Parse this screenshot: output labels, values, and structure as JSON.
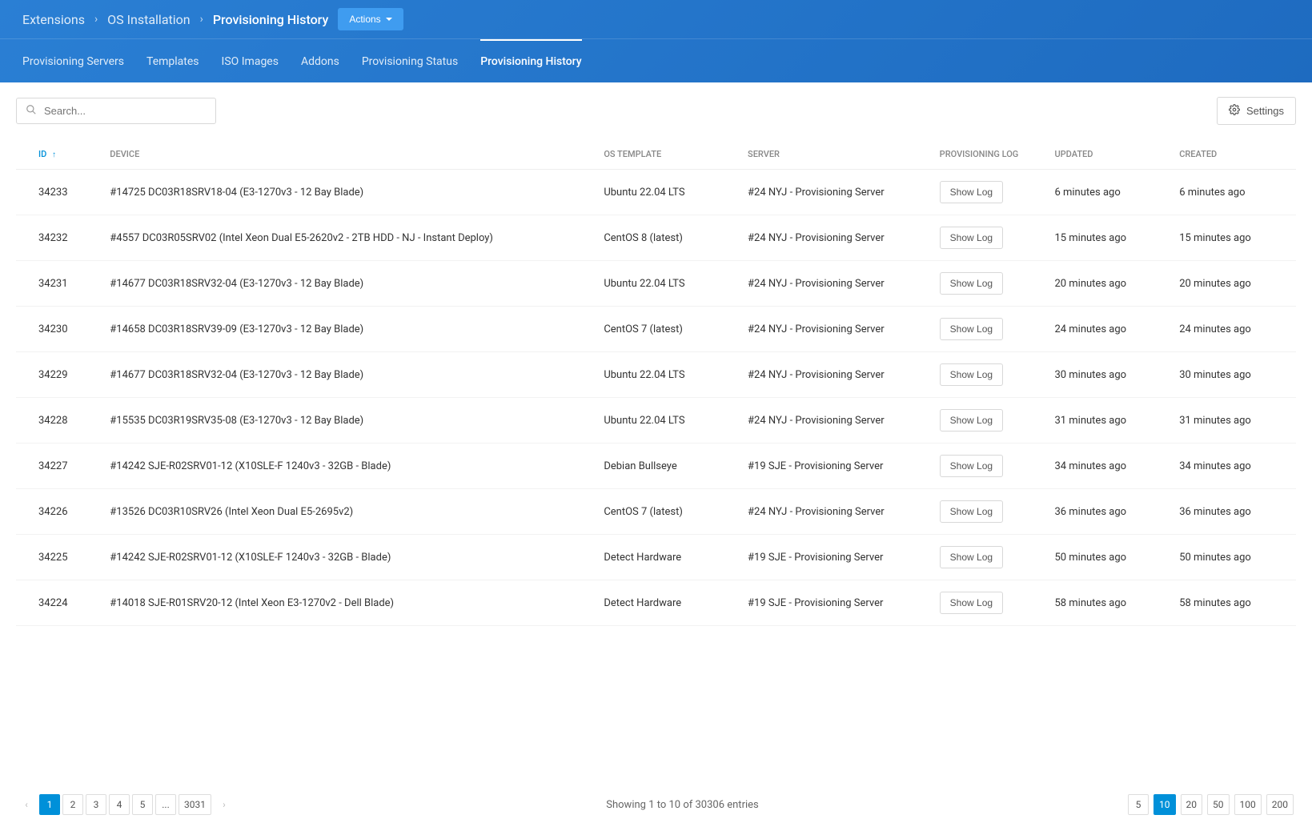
{
  "breadcrumb": {
    "items": [
      "Extensions",
      "OS Installation",
      "Provisioning History"
    ],
    "actions_label": "Actions"
  },
  "tabs": [
    {
      "label": "Provisioning Servers",
      "active": false
    },
    {
      "label": "Templates",
      "active": false
    },
    {
      "label": "ISO Images",
      "active": false
    },
    {
      "label": "Addons",
      "active": false
    },
    {
      "label": "Provisioning Status",
      "active": false
    },
    {
      "label": "Provisioning History",
      "active": true
    }
  ],
  "search": {
    "placeholder": "Search..."
  },
  "settings_label": "Settings",
  "columns": {
    "id": "ID",
    "device": "DEVICE",
    "os_template": "OS TEMPLATE",
    "server": "SERVER",
    "provisioning_log": "PROVISIONING LOG",
    "updated": "UPDATED",
    "created": "CREATED"
  },
  "show_log_label": "Show Log",
  "rows": [
    {
      "id": "34233",
      "device": "#14725 DC03R18SRV18-04 (E3-1270v3 - 12 Bay Blade)",
      "template": "Ubuntu 22.04 LTS",
      "server": "#24 NYJ - Provisioning Server",
      "updated": "6 minutes ago",
      "created": "6 minutes ago"
    },
    {
      "id": "34232",
      "device": "#4557 DC03R05SRV02 (Intel Xeon Dual E5-2620v2 - 2TB HDD - NJ - Instant Deploy)",
      "template": "CentOS 8 (latest)",
      "server": "#24 NYJ - Provisioning Server",
      "updated": "15 minutes ago",
      "created": "15 minutes ago"
    },
    {
      "id": "34231",
      "device": "#14677 DC03R18SRV32-04 (E3-1270v3 - 12 Bay Blade)",
      "template": "Ubuntu 22.04 LTS",
      "server": "#24 NYJ - Provisioning Server",
      "updated": "20 minutes ago",
      "created": "20 minutes ago"
    },
    {
      "id": "34230",
      "device": "#14658 DC03R18SRV39-09 (E3-1270v3 - 12 Bay Blade)",
      "template": "CentOS 7 (latest)",
      "server": "#24 NYJ - Provisioning Server",
      "updated": "24 minutes ago",
      "created": "24 minutes ago"
    },
    {
      "id": "34229",
      "device": "#14677 DC03R18SRV32-04 (E3-1270v3 - 12 Bay Blade)",
      "template": "Ubuntu 22.04 LTS",
      "server": "#24 NYJ - Provisioning Server",
      "updated": "30 minutes ago",
      "created": "30 minutes ago"
    },
    {
      "id": "34228",
      "device": "#15535 DC03R19SRV35-08 (E3-1270v3 - 12 Bay Blade)",
      "template": "Ubuntu 22.04 LTS",
      "server": "#24 NYJ - Provisioning Server",
      "updated": "31 minutes ago",
      "created": "31 minutes ago"
    },
    {
      "id": "34227",
      "device": "#14242 SJE-R02SRV01-12 (X10SLE-F 1240v3 - 32GB - Blade)",
      "template": "Debian Bullseye",
      "server": "#19 SJE - Provisioning Server",
      "updated": "34 minutes ago",
      "created": "34 minutes ago"
    },
    {
      "id": "34226",
      "device": "#13526 DC03R10SRV26 (Intel Xeon Dual E5-2695v2)",
      "template": "CentOS 7 (latest)",
      "server": "#24 NYJ - Provisioning Server",
      "updated": "36 minutes ago",
      "created": "36 minutes ago"
    },
    {
      "id": "34225",
      "device": "#14242 SJE-R02SRV01-12 (X10SLE-F 1240v3 - 32GB - Blade)",
      "template": "Detect Hardware",
      "server": "#19 SJE - Provisioning Server",
      "updated": "50 minutes ago",
      "created": "50 minutes ago"
    },
    {
      "id": "34224",
      "device": "#14018 SJE-R01SRV20-12 (Intel Xeon E3-1270v2 - Dell Blade)",
      "template": "Detect Hardware",
      "server": "#19 SJE - Provisioning Server",
      "updated": "58 minutes ago",
      "created": "58 minutes ago"
    }
  ],
  "pagination": {
    "pages": [
      "1",
      "2",
      "3",
      "4",
      "5",
      "...",
      "3031"
    ],
    "active_page": "1",
    "entries_text": "Showing 1 to 10 of 30306 entries",
    "page_sizes": [
      "5",
      "10",
      "20",
      "50",
      "100",
      "200"
    ],
    "active_size": "10"
  }
}
